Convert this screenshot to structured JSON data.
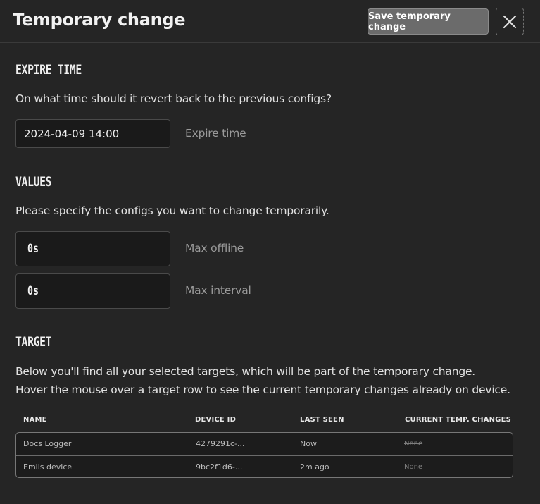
{
  "header": {
    "title": "Temporary change",
    "save_label": "Save temporary change",
    "close_icon": "close-icon"
  },
  "expire": {
    "heading": "EXPIRE TIME",
    "description": "On what time should it revert back to the previous configs?",
    "value": "2024-04-09 14:00",
    "label": "Expire time"
  },
  "values": {
    "heading": "VALUES",
    "description": "Please specify the configs you want to change temporarily.",
    "fields": [
      {
        "value": "0s",
        "label": "Max offline"
      },
      {
        "value": "0s",
        "label": "Max interval"
      }
    ]
  },
  "target": {
    "heading": "TARGET",
    "description_line1": "Below you'll find all your selected targets, which will be part of the temporary change.",
    "description_line2": "Hover the mouse over a target row to see the current temporary changes already on device.",
    "columns": [
      "NAME",
      "DEVICE ID",
      "LAST SEEN",
      "CURRENT TEMP. CHANGES"
    ],
    "rows": [
      {
        "name": "Docs Logger",
        "device_id": "4279291c-...",
        "last_seen": "Now",
        "changes": "None"
      },
      {
        "name": "Emils device",
        "device_id": "9bc2f1d6-...",
        "last_seen": "2m ago",
        "changes": "None"
      }
    ]
  }
}
